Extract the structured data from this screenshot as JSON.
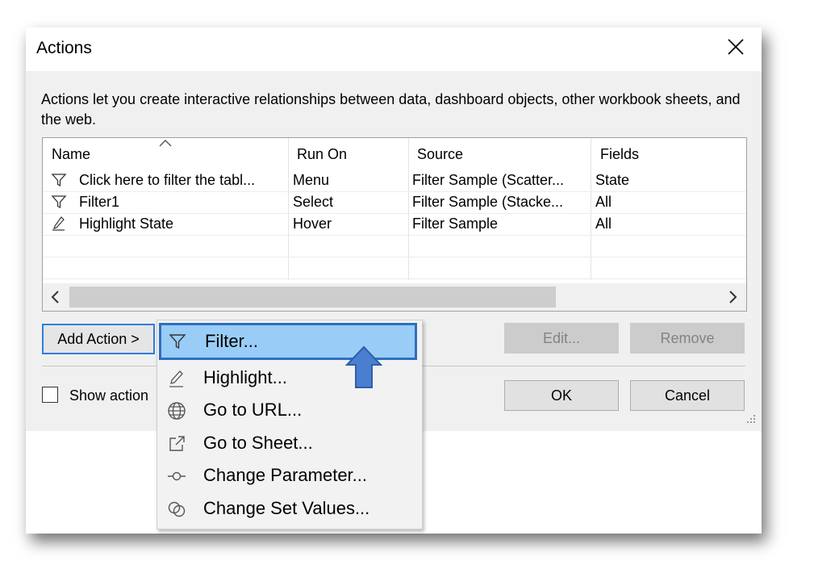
{
  "window": {
    "title": "Actions"
  },
  "description": "Actions let you create interactive relationships between data, dashboard objects, other workbook sheets, and the web.",
  "table": {
    "columns": [
      "Name",
      "Run On",
      "Source",
      "Fields"
    ],
    "rows": [
      {
        "icon": "filter-icon",
        "name": "Click here to filter the tabl...",
        "run_on": "Menu",
        "source": "Filter Sample (Scatter...",
        "fields": "State"
      },
      {
        "icon": "filter-icon",
        "name": "Filter1",
        "run_on": "Select",
        "source": "Filter Sample (Stacke...",
        "fields": "All"
      },
      {
        "icon": "highlight-icon",
        "name": "Highlight State",
        "run_on": "Hover",
        "source": "Filter Sample",
        "fields": "All"
      }
    ]
  },
  "buttons": {
    "add_action": "Add Action >",
    "edit": "Edit...",
    "remove": "Remove",
    "ok": "OK",
    "cancel": "Cancel"
  },
  "checkbox": {
    "label": "Show action",
    "checked": false
  },
  "menu": {
    "items": [
      {
        "label": "Filter...",
        "icon": "filter-icon",
        "selected": true
      },
      {
        "label": "Highlight...",
        "icon": "highlight-icon",
        "selected": false
      },
      {
        "label": "Go to URL...",
        "icon": "globe-icon",
        "selected": false
      },
      {
        "label": "Go to Sheet...",
        "icon": "external-link-icon",
        "selected": false
      },
      {
        "label": "Change Parameter...",
        "icon": "parameter-icon",
        "selected": false
      },
      {
        "label": "Change Set Values...",
        "icon": "set-values-icon",
        "selected": false
      }
    ]
  },
  "colors": {
    "accent_border": "#2f6fbf",
    "selected_bg": "#99cdf7",
    "arrow_fill": "#4a7fd0"
  }
}
